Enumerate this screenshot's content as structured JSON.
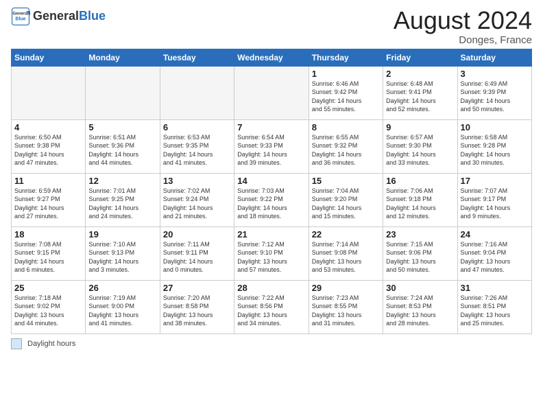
{
  "header": {
    "logo_text_general": "General",
    "logo_text_blue": "Blue",
    "month_title": "August 2024",
    "location": "Donges, France"
  },
  "days_of_week": [
    "Sunday",
    "Monday",
    "Tuesday",
    "Wednesday",
    "Thursday",
    "Friday",
    "Saturday"
  ],
  "weeks": [
    [
      {
        "num": "",
        "info": ""
      },
      {
        "num": "",
        "info": ""
      },
      {
        "num": "",
        "info": ""
      },
      {
        "num": "",
        "info": ""
      },
      {
        "num": "1",
        "info": "Sunrise: 6:46 AM\nSunset: 9:42 PM\nDaylight: 14 hours\nand 55 minutes."
      },
      {
        "num": "2",
        "info": "Sunrise: 6:48 AM\nSunset: 9:41 PM\nDaylight: 14 hours\nand 52 minutes."
      },
      {
        "num": "3",
        "info": "Sunrise: 6:49 AM\nSunset: 9:39 PM\nDaylight: 14 hours\nand 50 minutes."
      }
    ],
    [
      {
        "num": "4",
        "info": "Sunrise: 6:50 AM\nSunset: 9:38 PM\nDaylight: 14 hours\nand 47 minutes."
      },
      {
        "num": "5",
        "info": "Sunrise: 6:51 AM\nSunset: 9:36 PM\nDaylight: 14 hours\nand 44 minutes."
      },
      {
        "num": "6",
        "info": "Sunrise: 6:53 AM\nSunset: 9:35 PM\nDaylight: 14 hours\nand 41 minutes."
      },
      {
        "num": "7",
        "info": "Sunrise: 6:54 AM\nSunset: 9:33 PM\nDaylight: 14 hours\nand 39 minutes."
      },
      {
        "num": "8",
        "info": "Sunrise: 6:55 AM\nSunset: 9:32 PM\nDaylight: 14 hours\nand 36 minutes."
      },
      {
        "num": "9",
        "info": "Sunrise: 6:57 AM\nSunset: 9:30 PM\nDaylight: 14 hours\nand 33 minutes."
      },
      {
        "num": "10",
        "info": "Sunrise: 6:58 AM\nSunset: 9:28 PM\nDaylight: 14 hours\nand 30 minutes."
      }
    ],
    [
      {
        "num": "11",
        "info": "Sunrise: 6:59 AM\nSunset: 9:27 PM\nDaylight: 14 hours\nand 27 minutes."
      },
      {
        "num": "12",
        "info": "Sunrise: 7:01 AM\nSunset: 9:25 PM\nDaylight: 14 hours\nand 24 minutes."
      },
      {
        "num": "13",
        "info": "Sunrise: 7:02 AM\nSunset: 9:24 PM\nDaylight: 14 hours\nand 21 minutes."
      },
      {
        "num": "14",
        "info": "Sunrise: 7:03 AM\nSunset: 9:22 PM\nDaylight: 14 hours\nand 18 minutes."
      },
      {
        "num": "15",
        "info": "Sunrise: 7:04 AM\nSunset: 9:20 PM\nDaylight: 14 hours\nand 15 minutes."
      },
      {
        "num": "16",
        "info": "Sunrise: 7:06 AM\nSunset: 9:18 PM\nDaylight: 14 hours\nand 12 minutes."
      },
      {
        "num": "17",
        "info": "Sunrise: 7:07 AM\nSunset: 9:17 PM\nDaylight: 14 hours\nand 9 minutes."
      }
    ],
    [
      {
        "num": "18",
        "info": "Sunrise: 7:08 AM\nSunset: 9:15 PM\nDaylight: 14 hours\nand 6 minutes."
      },
      {
        "num": "19",
        "info": "Sunrise: 7:10 AM\nSunset: 9:13 PM\nDaylight: 14 hours\nand 3 minutes."
      },
      {
        "num": "20",
        "info": "Sunrise: 7:11 AM\nSunset: 9:11 PM\nDaylight: 14 hours\nand 0 minutes."
      },
      {
        "num": "21",
        "info": "Sunrise: 7:12 AM\nSunset: 9:10 PM\nDaylight: 13 hours\nand 57 minutes."
      },
      {
        "num": "22",
        "info": "Sunrise: 7:14 AM\nSunset: 9:08 PM\nDaylight: 13 hours\nand 53 minutes."
      },
      {
        "num": "23",
        "info": "Sunrise: 7:15 AM\nSunset: 9:06 PM\nDaylight: 13 hours\nand 50 minutes."
      },
      {
        "num": "24",
        "info": "Sunrise: 7:16 AM\nSunset: 9:04 PM\nDaylight: 13 hours\nand 47 minutes."
      }
    ],
    [
      {
        "num": "25",
        "info": "Sunrise: 7:18 AM\nSunset: 9:02 PM\nDaylight: 13 hours\nand 44 minutes."
      },
      {
        "num": "26",
        "info": "Sunrise: 7:19 AM\nSunset: 9:00 PM\nDaylight: 13 hours\nand 41 minutes."
      },
      {
        "num": "27",
        "info": "Sunrise: 7:20 AM\nSunset: 8:58 PM\nDaylight: 13 hours\nand 38 minutes."
      },
      {
        "num": "28",
        "info": "Sunrise: 7:22 AM\nSunset: 8:56 PM\nDaylight: 13 hours\nand 34 minutes."
      },
      {
        "num": "29",
        "info": "Sunrise: 7:23 AM\nSunset: 8:55 PM\nDaylight: 13 hours\nand 31 minutes."
      },
      {
        "num": "30",
        "info": "Sunrise: 7:24 AM\nSunset: 8:53 PM\nDaylight: 13 hours\nand 28 minutes."
      },
      {
        "num": "31",
        "info": "Sunrise: 7:26 AM\nSunset: 8:51 PM\nDaylight: 13 hours\nand 25 minutes."
      }
    ]
  ],
  "footer": {
    "legend_label": "Daylight hours"
  }
}
